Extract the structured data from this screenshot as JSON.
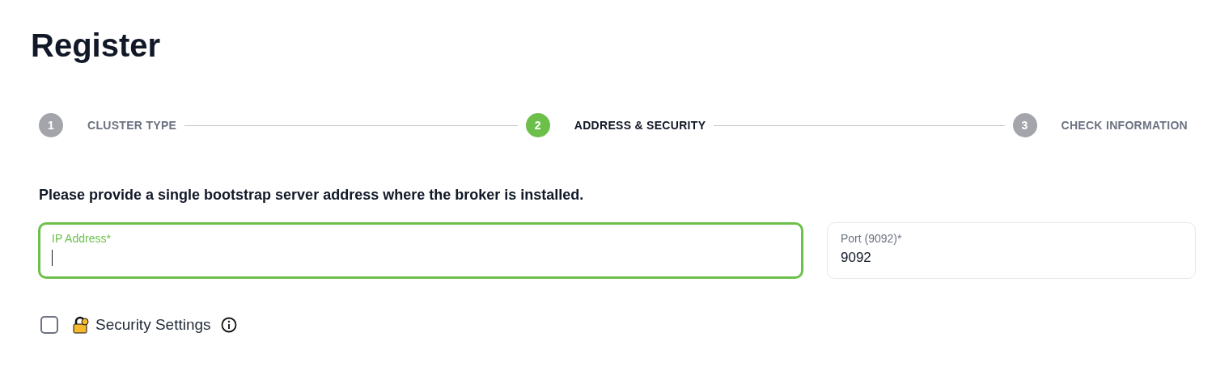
{
  "title": "Register",
  "steps": [
    {
      "number": "1",
      "label": "CLUSTER TYPE",
      "selected": false
    },
    {
      "number": "2",
      "label": "ADDRESS & SECURITY",
      "selected": true
    },
    {
      "number": "3",
      "label": "CHECK INFORMATION",
      "selected": false
    }
  ],
  "instruction": "Please provide a single bootstrap server address where the broker is installed.",
  "fields": [
    {
      "label": "IP Address*",
      "focused": true
    },
    {
      "label": "Port (9092)*",
      "value": "9092",
      "focused": false
    }
  ],
  "security": {
    "label": "Security Settings",
    "checked": false
  }
}
